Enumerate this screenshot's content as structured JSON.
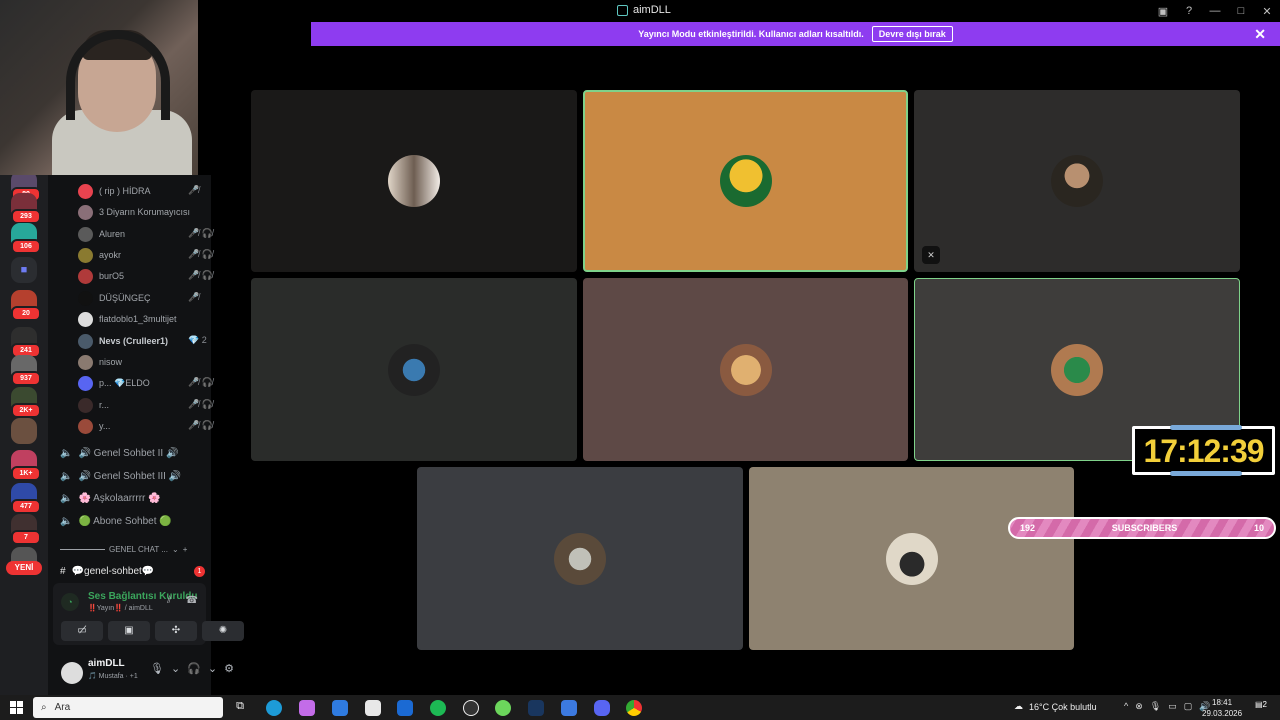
{
  "window": {
    "title": "aimDLL"
  },
  "banner": {
    "text": "Yayıncı Modu etkinleştirildi. Kullanıcı adları kısaltıldı.",
    "button_label": "Devre dışı bırak"
  },
  "server_badges": [
    "80",
    "293",
    "106",
    "20",
    "241",
    "937",
    "2K+",
    "1K+",
    "477",
    "7"
  ],
  "new_label": "YENİ",
  "members": [
    {
      "name": "( rip ) HİDRA",
      "icons": "🎤̸"
    },
    {
      "name": "3 Diyarın Korumayıcısı",
      "icons": ""
    },
    {
      "name": "Aluren",
      "icons": "🎤̸ 🎧̸"
    },
    {
      "name": "ayokr",
      "icons": "🎤̸ 🎧̸"
    },
    {
      "name": "burO5",
      "icons": "🎤̸ 🎧̸"
    },
    {
      "name": "DÜŞÜNGEÇ",
      "icons": "🎤̸"
    },
    {
      "name": "flatdoblo1_3multijet",
      "icons": ""
    },
    {
      "name": "Nevs (Crulleer1)",
      "icons": "💎 2"
    },
    {
      "name": "nisow",
      "icons": ""
    },
    {
      "name": "p... 💎ELDO",
      "icons": "🎤̸ 🎧̸"
    },
    {
      "name": "r...",
      "icons": "🎤̸ 🎧̸"
    },
    {
      "name": "y...",
      "icons": "🎤̸ 🎧̸"
    }
  ],
  "voice_channels": [
    "🔊 Genel Sohbet II 🔊",
    "🔊 Genel Sohbet III 🔊",
    "🌸 Aşkolaarrrrr 🌸",
    "🟢 Abone Sohbet 🟢"
  ],
  "category": {
    "label": "GENEL CHAT ..."
  },
  "text_channel": {
    "name": "💬genel-sohbet💬",
    "unread": "1"
  },
  "voice_status": {
    "title": "Ses Bağlantısı Kuruldu",
    "subtitle": "‼️Yayın‼️ / aimDLL"
  },
  "user": {
    "name": "aimDLL",
    "activity": "🎵 Mustafa · +1"
  },
  "timer": {
    "text": "17:12:39"
  },
  "subscribers": {
    "left": "192",
    "label": "SUBSCRIBERS",
    "right": "10"
  },
  "taskbar": {
    "search_placeholder": "Ara",
    "weather": "16°C  Çok bulutlu",
    "time": "18:41",
    "date": "29.03.2026",
    "notif": "2"
  },
  "colors": {
    "banner": "#8e3cf0",
    "accent_green": "#3ba55c",
    "timer_text": "#f2cf3a",
    "speaking_border": "#7fd28a"
  }
}
